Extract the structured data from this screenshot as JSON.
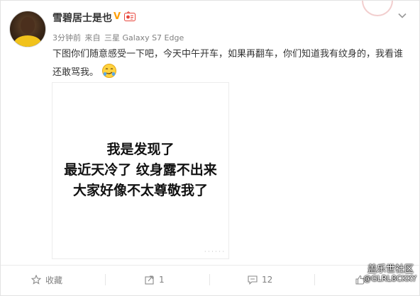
{
  "user": {
    "name": "雪碧居士是也",
    "verified_mark": "V",
    "avatar_icon": "user-avatar"
  },
  "meta": {
    "time": "3分钟前",
    "source_prefix": "来自",
    "source": "三星 Galaxy S7 Edge"
  },
  "post": {
    "text": "下图你们随意感受一下吧，今天中午开车，如果再翻车，你们知道我有纹身的，我看谁还敢骂我。",
    "emoji": "smirk-emoji"
  },
  "image": {
    "lines": [
      "我是发现了",
      "最近天冷了 纹身露不出来",
      "大家好像不太尊敬我了"
    ]
  },
  "actions": {
    "favorite_label": "收藏",
    "repost_count": "1",
    "comment_count": "12",
    "like_count": ""
  },
  "watermark": {
    "line1": "盖乐世社区",
    "line2": "@GLRL8CKKY"
  },
  "colors": {
    "verified": "#ffa00a",
    "text": "#333333",
    "meta": "#808080"
  }
}
